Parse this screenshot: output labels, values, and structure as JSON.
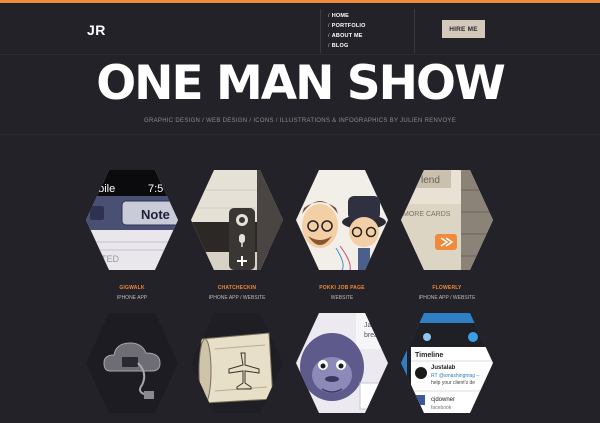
{
  "header": {
    "logo": "JR",
    "nav": [
      {
        "slash": "/",
        "label": "HOME"
      },
      {
        "slash": "/",
        "label": "PORTFOLIO"
      },
      {
        "slash": "/",
        "label": "ABOUT ME"
      },
      {
        "slash": "/",
        "label": "BLOG"
      }
    ],
    "hire_label": "HIRE ME"
  },
  "hero": {
    "title": "ONE MAN SHOW",
    "subtitle": "GRAPHIC DESIGN / WEB DESIGN / ICONS / ILLUSTRATIONS & INFOGRAPHICS BY JULIEN RENVOYE"
  },
  "portfolio": [
    {
      "title": "GIGWALK",
      "subtitle": "IPHONE APP",
      "art_text": [
        "obile",
        "7:5",
        "Note",
        "DITED"
      ]
    },
    {
      "title": "CHATCHECKIN",
      "subtitle": "IPHONE APP / WEBSITE"
    },
    {
      "title": "POKKI JOB PAGE",
      "subtitle": "WEBSITE"
    },
    {
      "title": "FLOWERLY",
      "subtitle": "IPHONE APP / WEBSITE",
      "art_text": [
        "lend",
        "MORE CARDS"
      ]
    },
    {
      "title": "",
      "subtitle": ""
    },
    {
      "title": "",
      "subtitle": ""
    },
    {
      "title": "",
      "subtitle": "",
      "art_text": [
        "Ja",
        "brea"
      ]
    },
    {
      "title": "",
      "subtitle": "",
      "art_text": [
        "Timeline",
        "Justalab",
        "RT @smashingmag –",
        "help your client's de",
        "cjdowner",
        "facebook"
      ]
    }
  ],
  "colors": {
    "accent": "#f08a3c",
    "background": "#232229",
    "button": "#d2c9bb"
  }
}
